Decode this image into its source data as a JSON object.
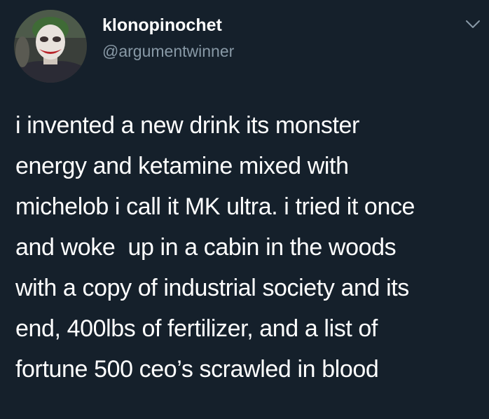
{
  "tweet": {
    "display_name": "klonopinochet",
    "handle": "@argumentwinner",
    "avatar_icon": "joker-face-avatar",
    "menu_icon": "chevron-down-icon",
    "text_lines": [
      "i invented a new drink its monster",
      "energy and ketamine mixed with",
      "michelob i call it MK ultra. i tried it once",
      "and woke  up in a cabin in the woods",
      "with a copy of industrial society and its",
      "end, 400lbs of fertilizer, and a list of",
      "fortune 500 ceo’s scrawled in blood"
    ]
  },
  "colors": {
    "background": "#15202b",
    "primary_text": "#ffffff",
    "secondary_text": "#8899a6",
    "caret": "#8899a6"
  }
}
